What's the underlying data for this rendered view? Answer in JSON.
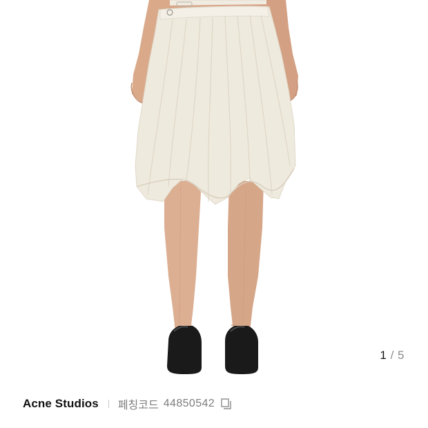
{
  "gallery": {
    "image_alt": "Ivory asymmetric pleated skirt with black clogs",
    "current_page": "1",
    "separator": "/",
    "total_pages": "5",
    "colors": {
      "skirt": "#efeade",
      "skin": "#d9a98a",
      "shoes": "#1a1a1a"
    }
  },
  "product": {
    "brand": "Acne Studios",
    "fetch_label": "페칭코드",
    "fetch_code": "44850542"
  },
  "icons": {
    "copy": "copy-icon"
  }
}
